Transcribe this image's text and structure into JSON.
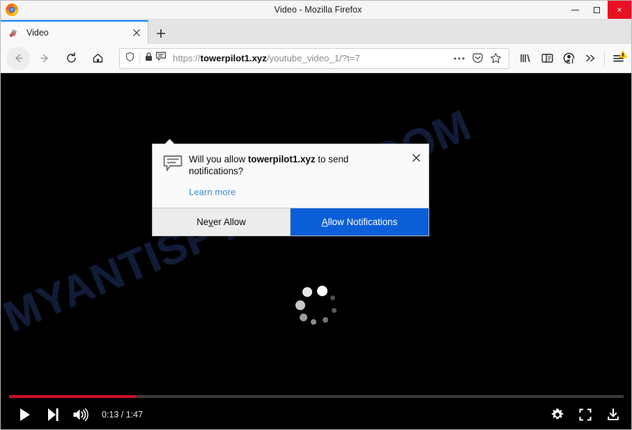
{
  "window": {
    "title": "Video - Mozilla Firefox",
    "controls": {
      "minimize": "minimize",
      "maximize": "maximize",
      "close": "×"
    }
  },
  "tabs": {
    "items": [
      {
        "label": "Video",
        "favicon": "video-favicon",
        "close": "×"
      }
    ],
    "new_tab_label": "+"
  },
  "toolbar": {
    "back": "back-arrow",
    "forward": "forward-arrow",
    "reload": "reload",
    "home": "home",
    "url": {
      "scheme": "https://",
      "host": "towerpilot1.xyz",
      "path": "/youtube_video_1/?t=7",
      "full": "https://towerpilot1.xyz/youtube_video_1/?t=7"
    },
    "page_actions": "…",
    "reader_icon": "pocket-icon",
    "bookmark_icon": "star-icon",
    "library_icon": "library-icon",
    "sidebar_icon": "sidebar-icon",
    "account_icon": "account-icon",
    "overflow_icon": "»",
    "menu_icon": "hamburger-menu",
    "menu_badge_color": "#ffbf00"
  },
  "popup": {
    "icon": "notification-bubble-icon",
    "message_prefix": "Will you allow ",
    "message_host": "towerpilot1.xyz",
    "message_suffix": " to send notifications?",
    "learn_more": "Learn more",
    "close": "✕",
    "buttons": {
      "deny": "Never Allow",
      "deny_accesskey": "v",
      "allow": "Allow Notifications",
      "allow_accesskey": "A"
    },
    "accent_color": "#0a5fd8",
    "link_color": "#3c8fd4"
  },
  "video": {
    "watermark": "MYANTISPYWARE.COM",
    "watermark_color": "#111c37",
    "loading_indicator": "spinner",
    "player": {
      "play": "play-button",
      "next": "next-button",
      "volume": "volume-button",
      "time_current": "0:13",
      "time_separator": "/",
      "time_total": "1:47",
      "time_display": "0:13 / 1:47",
      "settings": "settings-gear",
      "fullscreen": "fullscreen",
      "download": "download",
      "progress_percent": 20.8,
      "progress_color": "#cc0f23"
    }
  }
}
